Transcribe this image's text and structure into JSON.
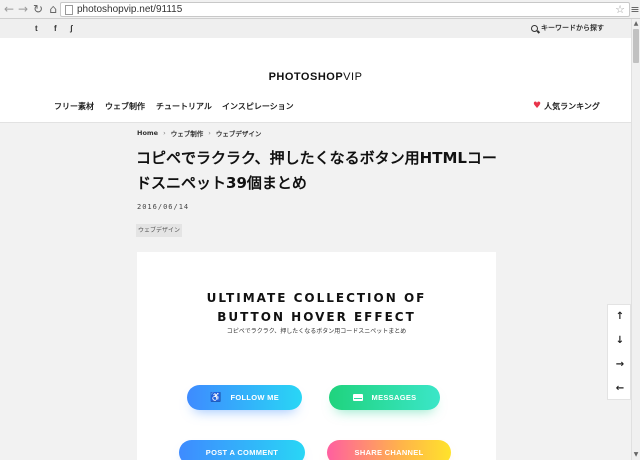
{
  "browser": {
    "back_icon": "arrow-left-icon",
    "forward_icon": "arrow-right-icon",
    "reload_icon": "reload-icon",
    "home_icon": "home-icon",
    "url": "photoshopvip.net/91115",
    "bookmark_icon": "star-icon",
    "menu_icon": "hamburger-icon"
  },
  "topbar": {
    "social": [
      {
        "icon": "twitter-icon",
        "glyph": "t"
      },
      {
        "icon": "facebook-icon",
        "glyph": "f"
      },
      {
        "icon": "rss-icon",
        "glyph": "ʃ"
      }
    ],
    "search_label": "キーワードから探す"
  },
  "header": {
    "logo_bold": "PHOTOSHOP",
    "logo_thin": "VIP",
    "nav": [
      "フリー素材",
      "ウェブ制作",
      "チュートリアル",
      "インスピレーション"
    ],
    "ranking_label": "人気ランキング",
    "ranking_icon": "heart-icon",
    "ranking_color": "#e8344a"
  },
  "article": {
    "breadcrumb": [
      "Home",
      "ウェブ制作",
      "ウェブデザイン"
    ],
    "breadcrumb_sep": "›",
    "title": "コピペでラクラク、押したくなるボタン用HTMLコードスニペット39個まとめ",
    "date": "2016/06/14",
    "tag": "ウェブデザイン"
  },
  "hero": {
    "heading_line1": "ULTIMATE COLLECTION OF",
    "heading_line2": "BUTTON HOVER EFFECT",
    "subtitle": "コピペでラクラク、押したくなるボタン用コードスニペットまとめ",
    "buttons": {
      "follow": "FOLLOW ME",
      "messages": "MESSAGES",
      "post": "POST A COMMENT",
      "share": "SHARE CHANNEL"
    },
    "colors": {
      "blue_start": "#3e8bff",
      "blue_end": "#29d6f5",
      "green_start": "#1fd37d",
      "green_end": "#3be6c8",
      "pink": "#ff5fa0",
      "yellow": "#ffe32b"
    }
  },
  "sidenav": {
    "items": [
      {
        "icon": "arrow-up-icon",
        "glyph": "↑"
      },
      {
        "icon": "arrow-down-icon",
        "glyph": "↓"
      },
      {
        "icon": "arrow-right-icon",
        "glyph": "→"
      },
      {
        "icon": "arrow-left-icon",
        "glyph": "←"
      }
    ]
  }
}
